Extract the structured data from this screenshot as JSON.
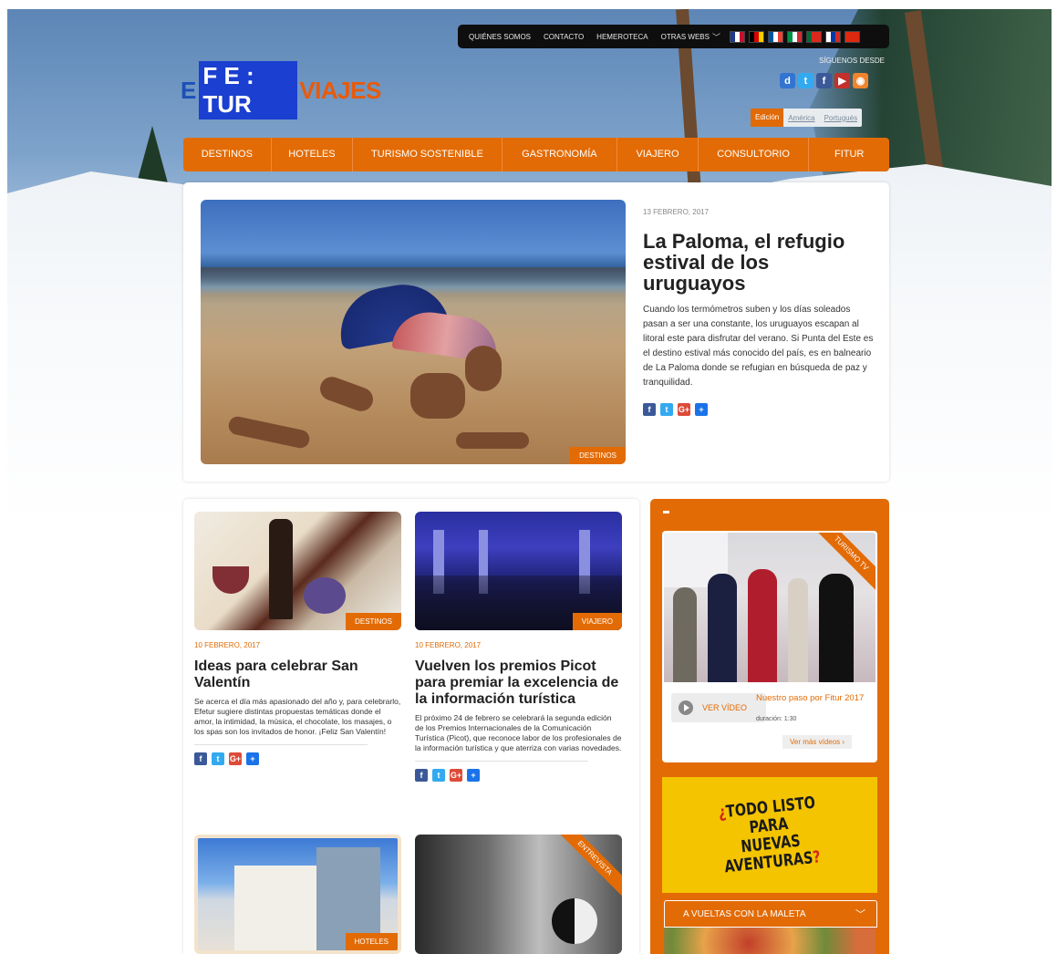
{
  "topbar": {
    "links": [
      "QUIÉNES SOMOS",
      "CONTACTO",
      "HEMEROTECA",
      "OTRAS WEBS"
    ],
    "flags": [
      {
        "name": "uk-flag",
        "colors": [
          "#1e3a8a",
          "#ffffff",
          "#c8102e"
        ]
      },
      {
        "name": "germany-flag",
        "colors": [
          "#000000",
          "#dd0000",
          "#ffce00"
        ]
      },
      {
        "name": "france-flag",
        "colors": [
          "#0055a4",
          "#ffffff",
          "#ef4135"
        ]
      },
      {
        "name": "italy-flag",
        "colors": [
          "#009246",
          "#ffffff",
          "#ce2b37"
        ]
      },
      {
        "name": "portugal-flag",
        "colors": [
          "#046a38",
          "#da291c",
          "#da291c"
        ]
      },
      {
        "name": "russia-flag",
        "colors": [
          "#ffffff",
          "#0039a6",
          "#d52b1e"
        ]
      },
      {
        "name": "china-flag",
        "colors": [
          "#de2910",
          "#de2910",
          "#de2910"
        ]
      }
    ]
  },
  "logo": {
    "efe_e": "E",
    "efe_block": "F E : TUR",
    "viajes": "VIAJES"
  },
  "follow": {
    "label": "SÍGUENOS DESDE"
  },
  "socials": [
    {
      "name": "delicious-icon",
      "glyph": "d",
      "color": "#3274d1"
    },
    {
      "name": "twitter-icon",
      "glyph": "t",
      "color": "#33aaf0"
    },
    {
      "name": "facebook-icon",
      "glyph": "f",
      "color": "#3b5998"
    },
    {
      "name": "youtube-icon",
      "glyph": "▶",
      "color": "#c4302b"
    },
    {
      "name": "rss-icon",
      "glyph": "◉",
      "color": "#f0842c"
    }
  ],
  "edition": {
    "label": "Edición",
    "options": [
      "América",
      "Portugués"
    ]
  },
  "nav": {
    "items": [
      "DESTINOS",
      "HOTELES",
      "TURISMO SOSTENIBLE",
      "GASTRONOMÍA",
      "VIAJERO",
      "CONSULTORIO",
      "FITUR"
    ]
  },
  "featured": {
    "date": "13 FEBRERO, 2017",
    "title": "La Paloma, el refugio estival de los uruguayos",
    "body": "Cuando los termómetros suben y los días soleados pasan a ser una constante, los uruguayos escapan al litoral este para disfrutar del verano. Si Punta del Este es el destino estival más conocido del país, es en balneario de La Paloma donde se refugian en búsqueda de paz y tranquilidad.",
    "tag": "DESTINOS"
  },
  "articles": [
    {
      "date": "10 FEBRERO, 2017",
      "title": "Ideas para celebrar San Valentín",
      "body": "Se acerca el día más apasionado del año y, para celebrarlo, Efetur sugiere distintas propuestas temáticas donde el amor, la intimidad, la música, el chocolate, los masajes, o los spas son los invitados de honor. ¡Feliz San Valentín!",
      "tag": "DESTINOS"
    },
    {
      "date": "10 FEBRERO, 2017",
      "title": "Vuelven los premios Picot para premiar la excelencia de la información turística",
      "body": "El próximo 24 de febrero se celebrará la segunda edición de los Premios Internacionales de la Comunicación Turística (Picot), que reconoce labor de los profesionales de la información turística y que aterriza con varias novedades.",
      "tag": "VIAJERO"
    },
    {
      "tag": "HOTELES"
    },
    {
      "tag": "ENTREVISTA"
    }
  ],
  "share_icons": [
    {
      "name": "facebook-share-icon",
      "glyph": "f",
      "color": "#3b5998"
    },
    {
      "name": "twitter-share-icon",
      "glyph": "t",
      "color": "#33aaf0"
    },
    {
      "name": "googleplus-share-icon",
      "glyph": "G+",
      "color": "#dd4b39"
    },
    {
      "name": "more-share-icon",
      "glyph": "+",
      "color": "#1a73e8"
    }
  ],
  "sidebar": {
    "ribbon": "TURISMO TV",
    "ver_video": "VER VÍDEO",
    "video_title": "Nuestro paso por Fitur 2017",
    "duration": "duración: 1:30",
    "ver_mas": "Ver más vídeos ›",
    "promo_lines": [
      "¿TODO LISTO",
      "PARA",
      "NUEVAS",
      "AVENTURAS?"
    ],
    "dropdown": "A VUELTAS CON LA MALETA"
  },
  "colors": {
    "accent": "#e36b05",
    "logo_blue": "#1b3fd0",
    "promo_yellow": "#f4c400"
  }
}
